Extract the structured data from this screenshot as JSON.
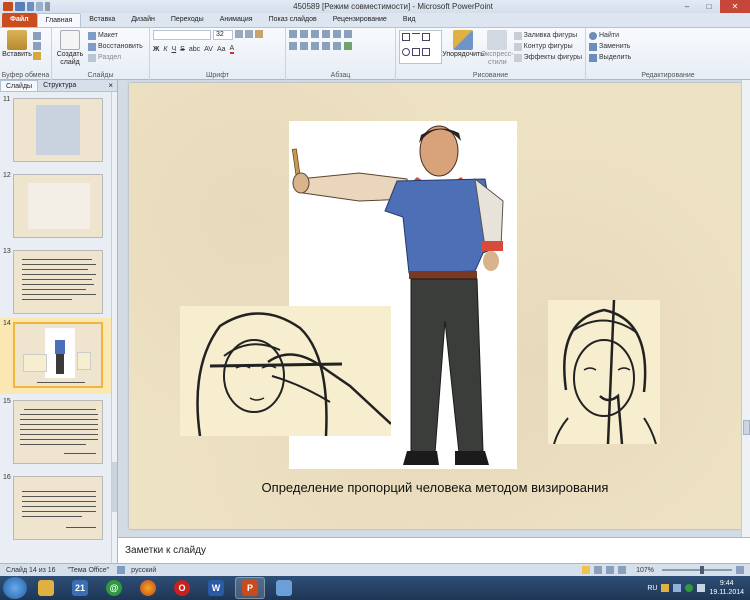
{
  "window": {
    "title": "450589 [Режим совместимости] - Microsoft PowerPoint",
    "min_icon": "minimize-icon",
    "max_icon": "maximize-icon",
    "close_icon": "close-icon"
  },
  "tabs": [
    "Файл",
    "Главная",
    "Вставка",
    "Дизайн",
    "Переходы",
    "Анимация",
    "Показ слайдов",
    "Рецензирование",
    "Вид"
  ],
  "ribbon": {
    "clipboard": {
      "paste": "Вставить",
      "label": "Буфер обмена"
    },
    "slides": {
      "new_slide_line1": "Создать",
      "new_slide_line2": "слайд",
      "layout": "Макет",
      "reset": "Восстановить",
      "section": "Раздел",
      "label": "Слайды"
    },
    "font": {
      "size": "32",
      "bold": "Ж",
      "italic": "К",
      "underline": "Ч",
      "strike": "S",
      "spacing": "abc",
      "shadow": "AV",
      "case": "Aa",
      "color": "A",
      "label": "Шрифт"
    },
    "paragraph": {
      "label": "Абзац"
    },
    "drawing": {
      "arrange": "Упорядочить",
      "quick_styles": "Экспресс-стили",
      "fill": "Заливка фигуры",
      "outline": "Контур фигуры",
      "effects": "Эффекты фигуры",
      "label": "Рисование"
    },
    "editing": {
      "find": "Найти",
      "replace": "Заменить",
      "select": "Выделить",
      "label": "Редактирование"
    }
  },
  "left_pane": {
    "tab_slides": "Слайды",
    "tab_outline": "Структура",
    "close": "×",
    "slides": [
      {
        "number": "11"
      },
      {
        "number": "12"
      },
      {
        "number": "13"
      },
      {
        "number": "14"
      },
      {
        "number": "15"
      },
      {
        "number": "16"
      }
    ]
  },
  "slide": {
    "caption": "Определение пропорций человека методом визирования"
  },
  "notes": {
    "placeholder": "Заметки к слайду"
  },
  "status": {
    "slide_info": "Слайд 14 из 16",
    "theme": "\"Тема Office\"",
    "language": "русский",
    "zoom": "107%"
  },
  "taskbar": {
    "apps": [
      {
        "name": "explorer",
        "glyph": "",
        "color": "#e0b040"
      },
      {
        "name": "calendar",
        "glyph": "21",
        "color": "#3b6fb5"
      },
      {
        "name": "at-mail",
        "glyph": "@",
        "color": "#2e9a3d"
      },
      {
        "name": "firefox",
        "glyph": "",
        "color": "#e07a1d"
      },
      {
        "name": "opera",
        "glyph": "O",
        "color": "#c8201f"
      },
      {
        "name": "word",
        "glyph": "W",
        "color": "#2a5aa8"
      },
      {
        "name": "powerpoint",
        "glyph": "P",
        "color": "#c84b1d"
      },
      {
        "name": "paint",
        "glyph": "",
        "color": "#6a9fd8"
      }
    ],
    "lang": "RU",
    "time": "9:44",
    "date": "19.11.2014"
  }
}
